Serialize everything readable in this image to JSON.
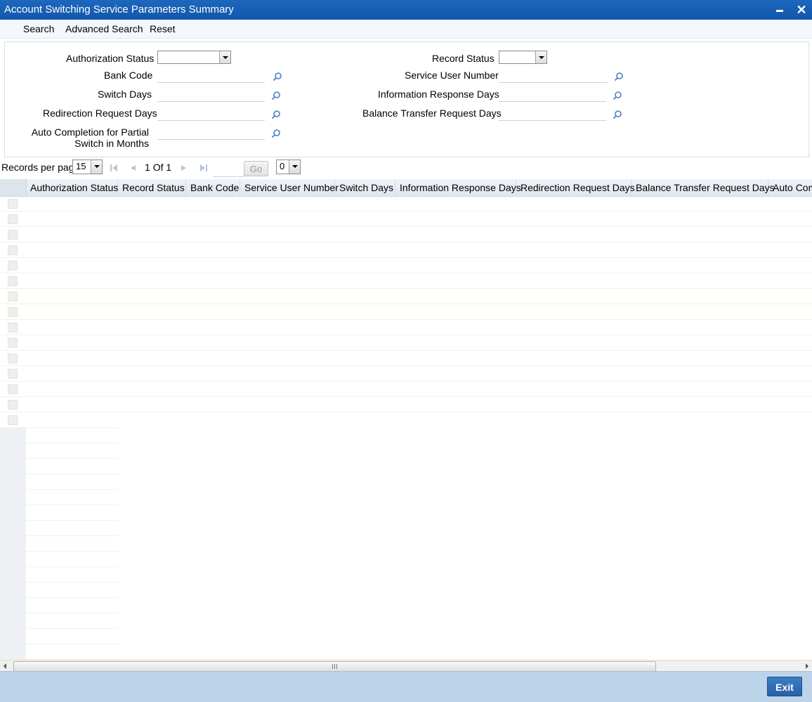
{
  "window": {
    "title": "Account Switching Service Parameters Summary"
  },
  "toolbar": {
    "search": "Search",
    "advanced_search": "Advanced Search",
    "reset": "Reset"
  },
  "form": {
    "authorization_status": "Authorization Status",
    "record_status": "Record Status",
    "bank_code": "Bank Code",
    "service_user_number": "Service User Number",
    "switch_days": "Switch Days",
    "information_response_days": "Information Response Days",
    "redirection_request_days": "Redirection Request Days",
    "balance_transfer_request_days": "Balance Transfer Request Days",
    "auto_completion": "Auto Completion for Partial Switch in Months"
  },
  "pagination": {
    "records_per_page_label": "Records per page",
    "records_per_page_value": "15",
    "current_page": "1",
    "of_label": "Of",
    "total_pages": "1",
    "go_label": "Go",
    "extra_select_value": "0"
  },
  "grid": {
    "columns": [
      "Authorization Status",
      "Record Status",
      "Bank Code",
      "Service User Number",
      "Switch Days",
      "Information Response Days",
      "Redirection Request Days",
      "Balance Transfer Request Days",
      "Auto Com"
    ]
  },
  "footer": {
    "exit": "Exit"
  },
  "colors": {
    "titlebar": "#1d67be",
    "footer": "#bcd4ea",
    "exit_button": "#2f6db8"
  }
}
